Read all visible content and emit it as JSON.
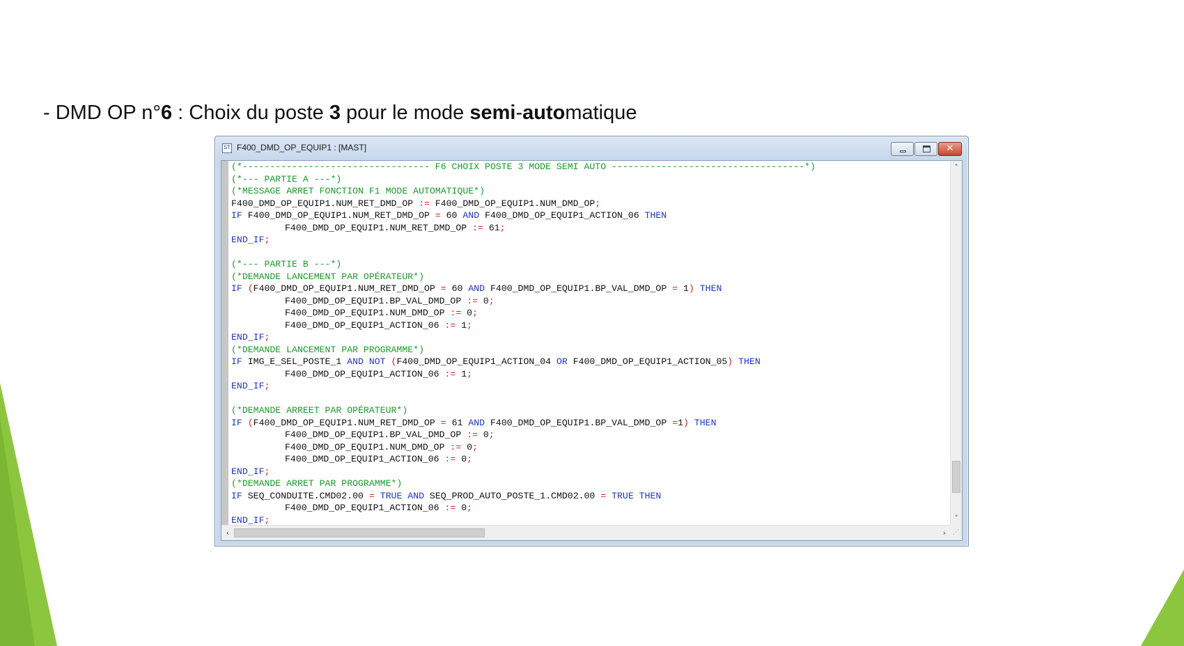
{
  "slide": {
    "heading": {
      "prefix": "- DMD OP n°",
      "num": "6",
      "mid": " : Choix du poste ",
      "poste": "3",
      "mid2": " pour le mode ",
      "bold1": "semi",
      "dash": "-",
      "bold2": "auto",
      "suffix": "matique"
    },
    "accent_color": "#8cc63f"
  },
  "window": {
    "title": "F400_DMD_OP_EQUIP1 : [MAST]",
    "icon_text": "ST",
    "buttons": {
      "minimize": "minimize",
      "maximize": "maximize",
      "close": "✕"
    },
    "scroll": {
      "up": "˄",
      "down": "˅",
      "left": "‹",
      "right": "›",
      "grip": "⋰"
    },
    "colors": {
      "keyword": "#1f33c9",
      "comment": "#1a9a2a",
      "operator": "#d0201a"
    }
  },
  "code": {
    "lines": [
      [
        {
          "t": "cm",
          "v": "(*---------------------------------- F6 CHOIX POSTE 3 MODE SEMI AUTO -----------------------------------*)"
        }
      ],
      [
        {
          "t": "cm",
          "v": "(*--- PARTIE A ---*)"
        }
      ],
      [
        {
          "t": "cm",
          "v": "(*MESSAGE ARRET FONCTION F1 MODE AUTOMATIQUE*)"
        }
      ],
      [
        {
          "t": "tx",
          "v": "F400_DMD_OP_EQUIP1.NUM_RET_DMD_OP "
        },
        {
          "t": "op",
          "v": ":="
        },
        {
          "t": "tx",
          "v": " F400_DMD_OP_EQUIP1.NUM_DMD_OP"
        },
        {
          "t": "op",
          "v": ";"
        }
      ],
      [
        {
          "t": "kw",
          "v": "IF"
        },
        {
          "t": "tx",
          "v": " F400_DMD_OP_EQUIP1.NUM_RET_DMD_OP "
        },
        {
          "t": "op",
          "v": "="
        },
        {
          "t": "tx",
          "v": " 60 "
        },
        {
          "t": "kw",
          "v": "AND"
        },
        {
          "t": "tx",
          "v": " F400_DMD_OP_EQUIP1_ACTION_06 "
        },
        {
          "t": "kw",
          "v": "THEN"
        }
      ],
      [
        {
          "t": "ind",
          "v": ""
        },
        {
          "t": "tx",
          "v": "F400_DMD_OP_EQUIP1.NUM_RET_DMD_OP "
        },
        {
          "t": "op",
          "v": ":="
        },
        {
          "t": "tx",
          "v": " 61"
        },
        {
          "t": "op",
          "v": ";"
        }
      ],
      [
        {
          "t": "kw",
          "v": "END_IF"
        },
        {
          "t": "op",
          "v": ";"
        }
      ],
      [
        {
          "t": "tx",
          "v": ""
        }
      ],
      [
        {
          "t": "cm",
          "v": "(*--- PARTIE B ---*)"
        }
      ],
      [
        {
          "t": "cm",
          "v": "(*DEMANDE LANCEMENT PAR OPÉRATEUR*)"
        }
      ],
      [
        {
          "t": "kw",
          "v": "IF"
        },
        {
          "t": "tx",
          "v": " "
        },
        {
          "t": "op",
          "v": "("
        },
        {
          "t": "tx",
          "v": "F400_DMD_OP_EQUIP1.NUM_RET_DMD_OP "
        },
        {
          "t": "op",
          "v": "="
        },
        {
          "t": "tx",
          "v": " 60 "
        },
        {
          "t": "kw",
          "v": "AND"
        },
        {
          "t": "tx",
          "v": " F400_DMD_OP_EQUIP1.BP_VAL_DMD_OP "
        },
        {
          "t": "op",
          "v": "="
        },
        {
          "t": "tx",
          "v": " 1"
        },
        {
          "t": "op",
          "v": ")"
        },
        {
          "t": "tx",
          "v": " "
        },
        {
          "t": "kw",
          "v": "THEN"
        }
      ],
      [
        {
          "t": "ind",
          "v": ""
        },
        {
          "t": "tx",
          "v": "F400_DMD_OP_EQUIP1.BP_VAL_DMD_OP "
        },
        {
          "t": "op",
          "v": ":="
        },
        {
          "t": "tx",
          "v": " 0"
        },
        {
          "t": "op",
          "v": ";"
        }
      ],
      [
        {
          "t": "ind",
          "v": ""
        },
        {
          "t": "tx",
          "v": "F400_DMD_OP_EQUIP1.NUM_DMD_OP "
        },
        {
          "t": "op",
          "v": ":="
        },
        {
          "t": "tx",
          "v": " 0"
        },
        {
          "t": "op",
          "v": ";"
        }
      ],
      [
        {
          "t": "ind",
          "v": ""
        },
        {
          "t": "tx",
          "v": "F400_DMD_OP_EQUIP1_ACTION_06 "
        },
        {
          "t": "op",
          "v": ":="
        },
        {
          "t": "tx",
          "v": " 1"
        },
        {
          "t": "op",
          "v": ";"
        }
      ],
      [
        {
          "t": "kw",
          "v": "END_IF"
        },
        {
          "t": "op",
          "v": ";"
        }
      ],
      [
        {
          "t": "cm",
          "v": "(*DEMANDE LANCEMENT PAR PROGRAMME*)"
        }
      ],
      [
        {
          "t": "kw",
          "v": "IF"
        },
        {
          "t": "tx",
          "v": " IMG_E_SEL_POSTE_1 "
        },
        {
          "t": "kw",
          "v": "AND NOT"
        },
        {
          "t": "tx",
          "v": " "
        },
        {
          "t": "op",
          "v": "("
        },
        {
          "t": "tx",
          "v": "F400_DMD_OP_EQUIP1_ACTION_04 "
        },
        {
          "t": "kw",
          "v": "OR"
        },
        {
          "t": "tx",
          "v": " F400_DMD_OP_EQUIP1_ACTION_05"
        },
        {
          "t": "op",
          "v": ")"
        },
        {
          "t": "tx",
          "v": " "
        },
        {
          "t": "kw",
          "v": "THEN"
        }
      ],
      [
        {
          "t": "ind",
          "v": ""
        },
        {
          "t": "tx",
          "v": "F400_DMD_OP_EQUIP1_ACTION_06 "
        },
        {
          "t": "op",
          "v": ":="
        },
        {
          "t": "tx",
          "v": " 1"
        },
        {
          "t": "op",
          "v": ";"
        }
      ],
      [
        {
          "t": "kw",
          "v": "END_IF"
        },
        {
          "t": "op",
          "v": ";"
        }
      ],
      [
        {
          "t": "tx",
          "v": ""
        }
      ],
      [
        {
          "t": "cm",
          "v": "(*DEMANDE ARREET PAR OPÉRATEUR*)"
        }
      ],
      [
        {
          "t": "kw",
          "v": "IF"
        },
        {
          "t": "tx",
          "v": " "
        },
        {
          "t": "op",
          "v": "("
        },
        {
          "t": "tx",
          "v": "F400_DMD_OP_EQUIP1.NUM_RET_DMD_OP "
        },
        {
          "t": "op",
          "v": "="
        },
        {
          "t": "tx",
          "v": " 61 "
        },
        {
          "t": "kw",
          "v": "AND"
        },
        {
          "t": "tx",
          "v": " F400_DMD_OP_EQUIP1.BP_VAL_DMD_OP "
        },
        {
          "t": "op",
          "v": "="
        },
        {
          "t": "tx",
          "v": "1"
        },
        {
          "t": "op",
          "v": ")"
        },
        {
          "t": "tx",
          "v": " "
        },
        {
          "t": "kw",
          "v": "THEN"
        }
      ],
      [
        {
          "t": "ind",
          "v": ""
        },
        {
          "t": "tx",
          "v": "F400_DMD_OP_EQUIP1.BP_VAL_DMD_OP "
        },
        {
          "t": "op",
          "v": ":="
        },
        {
          "t": "tx",
          "v": " 0"
        },
        {
          "t": "op",
          "v": ";"
        }
      ],
      [
        {
          "t": "ind",
          "v": ""
        },
        {
          "t": "tx",
          "v": "F400_DMD_OP_EQUIP1.NUM_DMD_OP "
        },
        {
          "t": "op",
          "v": ":="
        },
        {
          "t": "tx",
          "v": " 0"
        },
        {
          "t": "op",
          "v": ";"
        }
      ],
      [
        {
          "t": "ind",
          "v": ""
        },
        {
          "t": "tx",
          "v": "F400_DMD_OP_EQUIP1_ACTION_06 "
        },
        {
          "t": "op",
          "v": ":="
        },
        {
          "t": "tx",
          "v": " 0"
        },
        {
          "t": "op",
          "v": ";"
        }
      ],
      [
        {
          "t": "kw",
          "v": "END_IF"
        },
        {
          "t": "op",
          "v": ";"
        }
      ],
      [
        {
          "t": "cm",
          "v": "(*DEMANDE ARRET PAR PROGRAMME*)"
        }
      ],
      [
        {
          "t": "kw",
          "v": "IF"
        },
        {
          "t": "tx",
          "v": " SEQ_CONDUITE.CMD02.00 "
        },
        {
          "t": "op",
          "v": "="
        },
        {
          "t": "tx",
          "v": " "
        },
        {
          "t": "kw",
          "v": "TRUE AND"
        },
        {
          "t": "tx",
          "v": " SEQ_PROD_AUTO_POSTE_1.CMD02.00 "
        },
        {
          "t": "op",
          "v": "="
        },
        {
          "t": "tx",
          "v": " "
        },
        {
          "t": "kw",
          "v": "TRUE THEN"
        }
      ],
      [
        {
          "t": "ind",
          "v": ""
        },
        {
          "t": "tx",
          "v": "F400_DMD_OP_EQUIP1_ACTION_06 "
        },
        {
          "t": "op",
          "v": ":="
        },
        {
          "t": "tx",
          "v": " 0"
        },
        {
          "t": "op",
          "v": ";"
        }
      ],
      [
        {
          "t": "kw",
          "v": "END_IF"
        },
        {
          "t": "op",
          "v": ";"
        }
      ]
    ]
  }
}
